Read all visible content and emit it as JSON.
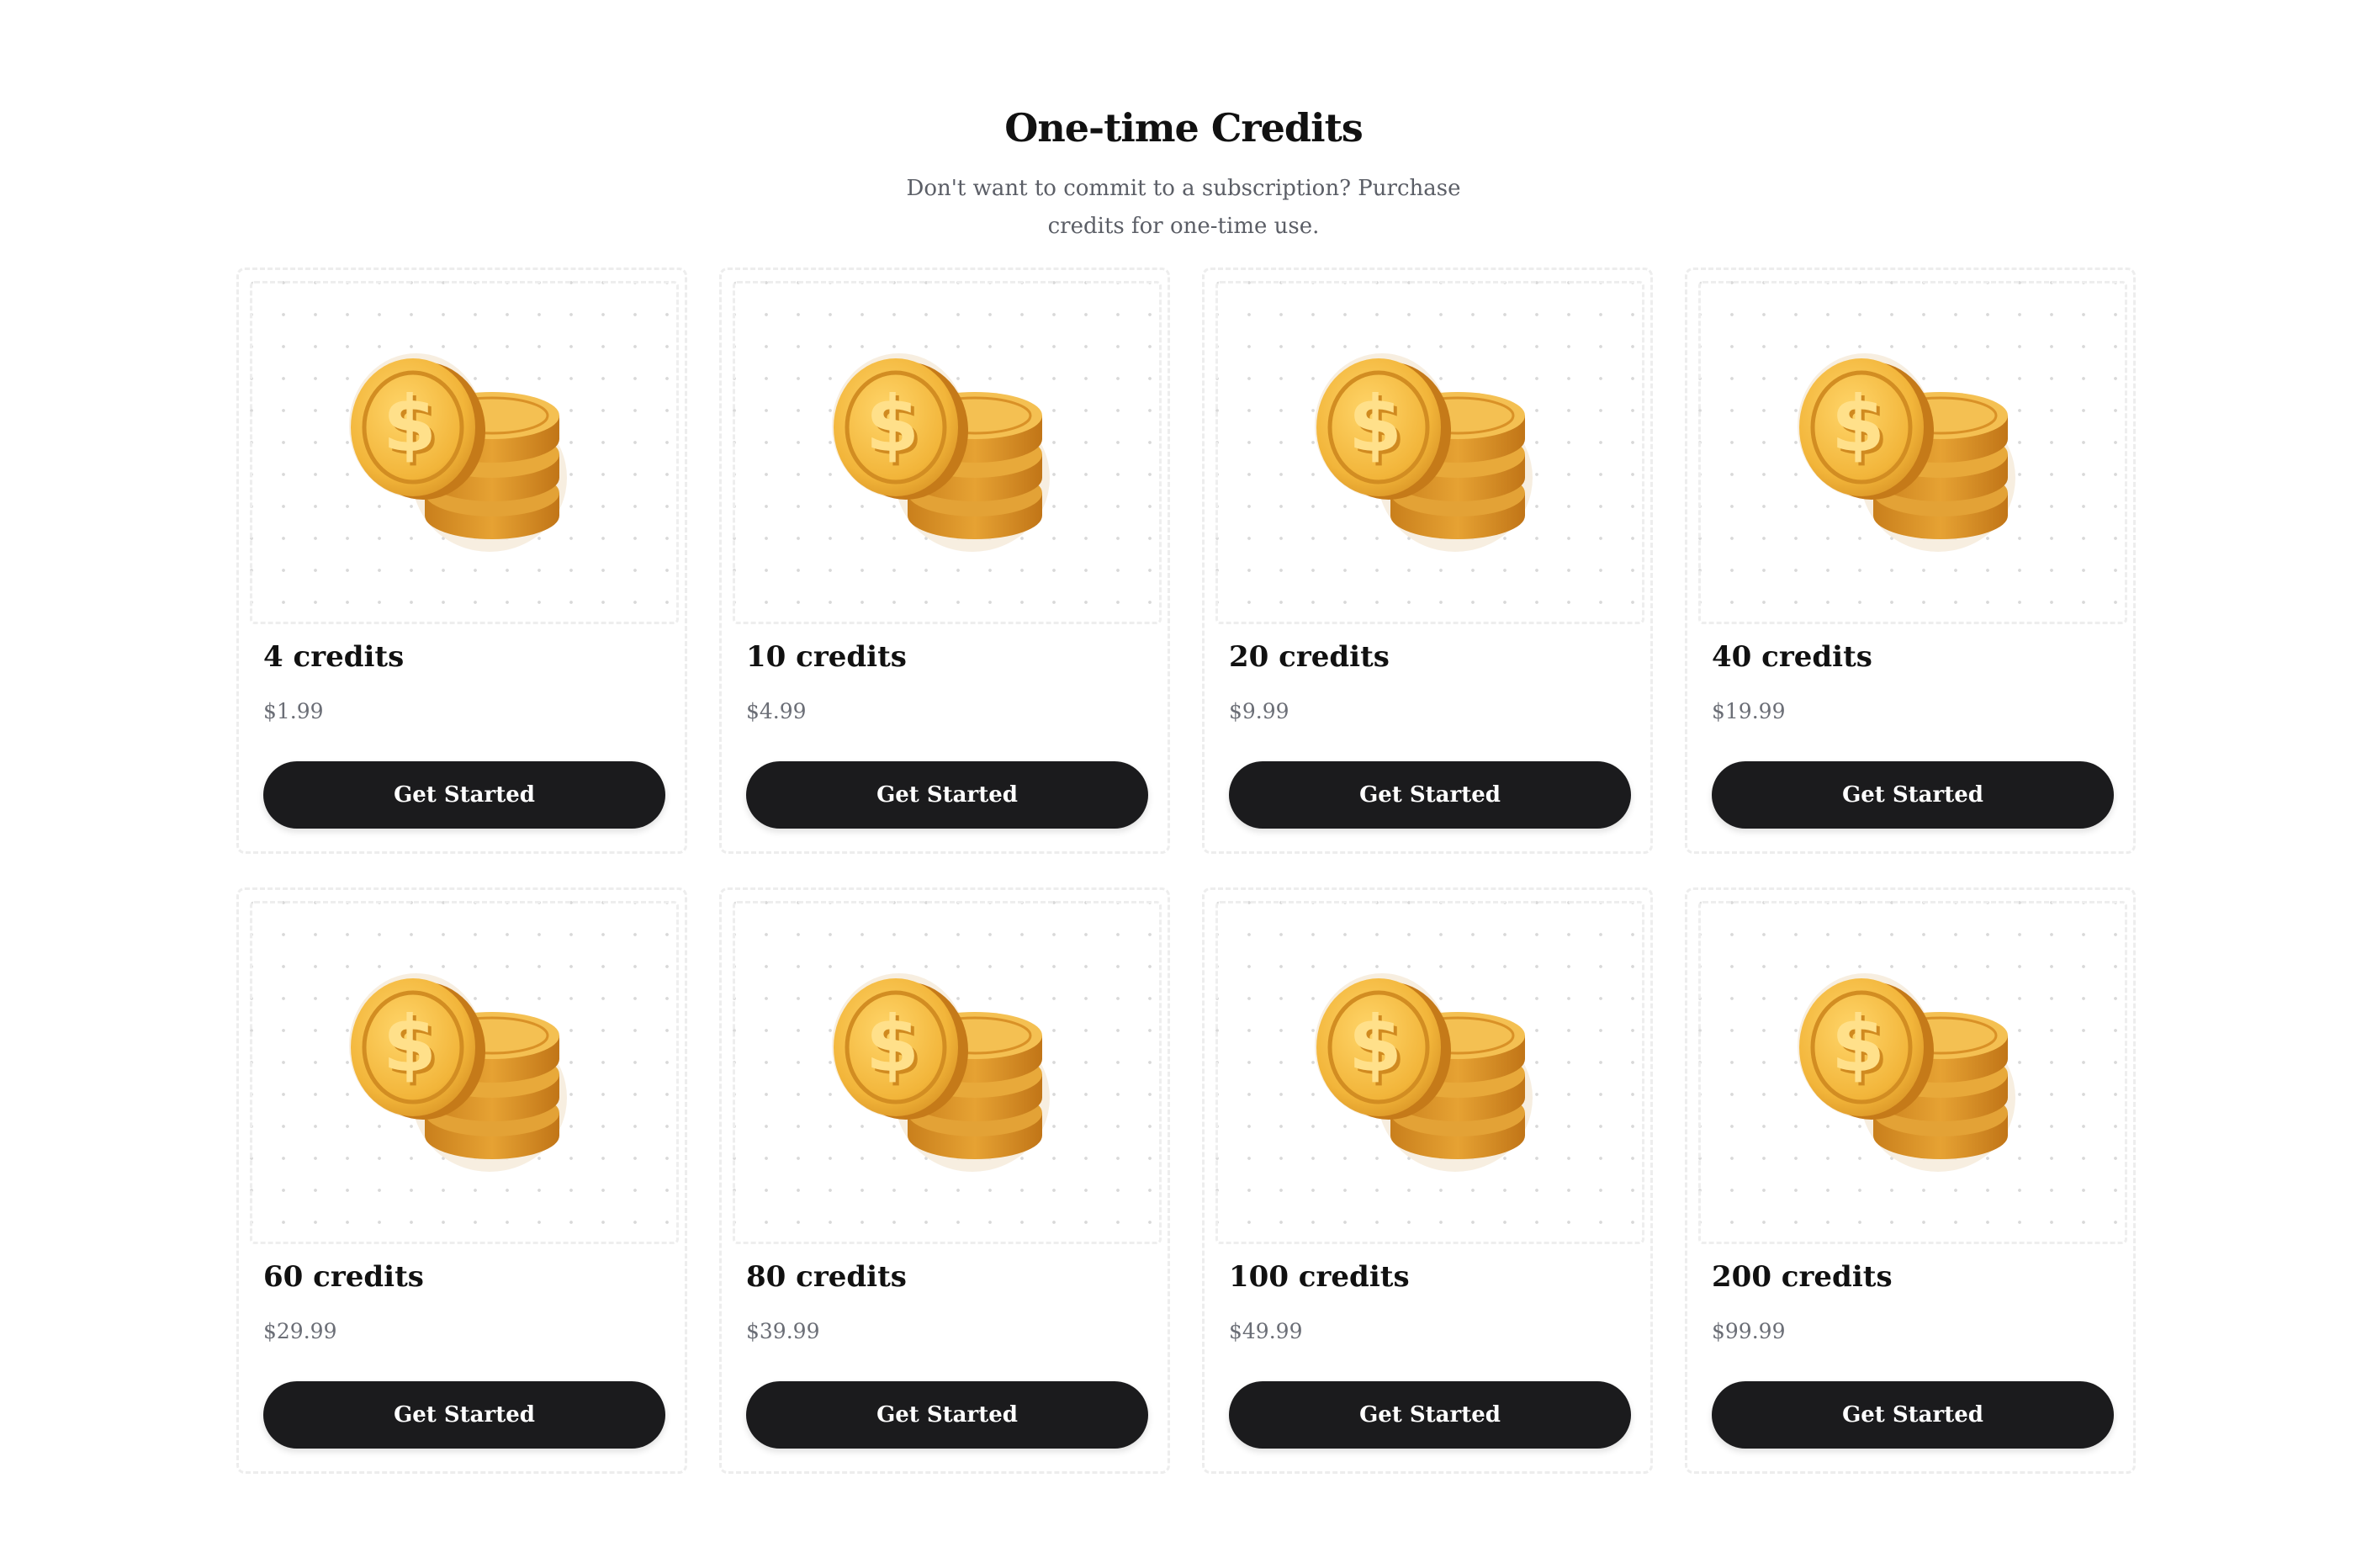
{
  "header": {
    "title": "One-time Credits",
    "subtitle": "Don't want to commit to a subscription? Purchase credits for one-time use."
  },
  "packages": [
    {
      "credits": "4 credits",
      "price": "$1.99",
      "cta": "Get Started"
    },
    {
      "credits": "10 credits",
      "price": "$4.99",
      "cta": "Get Started"
    },
    {
      "credits": "20 credits",
      "price": "$9.99",
      "cta": "Get Started"
    },
    {
      "credits": "40 credits",
      "price": "$19.99",
      "cta": "Get Started"
    },
    {
      "credits": "60 credits",
      "price": "$29.99",
      "cta": "Get Started"
    },
    {
      "credits": "80 credits",
      "price": "$39.99",
      "cta": "Get Started"
    },
    {
      "credits": "100 credits",
      "price": "$49.99",
      "cta": "Get Started"
    },
    {
      "credits": "200 credits",
      "price": "$99.99",
      "cta": "Get Started"
    }
  ],
  "icons": {
    "package_image": "coin-stack-icon"
  },
  "colors": {
    "button_bg": "#1b1b1d",
    "coin_gold": "#f0b43a"
  }
}
